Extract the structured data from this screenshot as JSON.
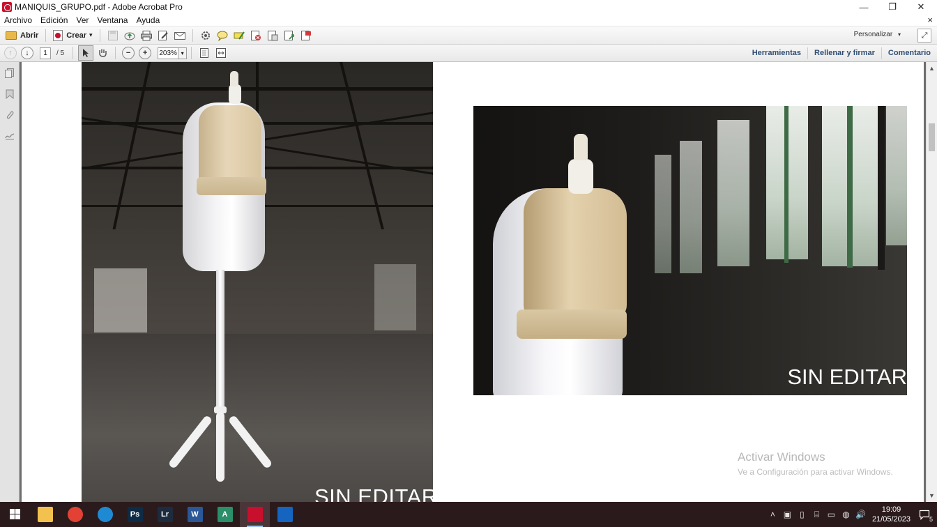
{
  "window": {
    "title": "MANIQUIS_GRUPO.pdf - Adobe Acrobat Pro",
    "minimize_glyph": "—",
    "restore_glyph": "❐",
    "close_glyph": "✕"
  },
  "menu": {
    "items": [
      "Archivo",
      "Edición",
      "Ver",
      "Ventana",
      "Ayuda"
    ],
    "close_doc_glyph": "×"
  },
  "toolbar": {
    "open_label": "Abrir",
    "create_label": "Crear",
    "create_dropdown_glyph": "▾",
    "personalizar_label": "Personalizar",
    "personalizar_dropdown_glyph": "▾",
    "icons": [
      "save-icon",
      "upload-cloud-icon",
      "print-icon",
      "edit-document-icon",
      "email-icon",
      "settings-gear-icon",
      "comment-bubble-icon",
      "highlight-marker-icon",
      "pdf-delete-icon",
      "pdf-export-icon",
      "pdf-combine-icon",
      "pdf-sign-icon"
    ]
  },
  "nav": {
    "current_page": "1",
    "total_pages": "/ 5",
    "zoom": "203%",
    "zoom_dropdown_glyph": "▾",
    "panels": [
      "Herramientas",
      "Rellenar y firmar",
      "Comentario"
    ]
  },
  "document": {
    "caption_left": "SIN EDITAR",
    "caption_right": "SIN EDITAR"
  },
  "watermark": {
    "title": "Activar Windows",
    "subtitle": "Ve a Configuración para activar Windows."
  },
  "taskbar": {
    "apps": [
      {
        "name": "file-explorer",
        "label": "",
        "color": "#f2c14e",
        "active": false
      },
      {
        "name": "chrome",
        "label": "",
        "color": "#e34133",
        "active": false
      },
      {
        "name": "edge",
        "label": "",
        "color": "#1f8ad4",
        "active": false
      },
      {
        "name": "photoshop",
        "label": "Ps",
        "color": "#0e2b45",
        "active": false
      },
      {
        "name": "lightroom",
        "label": "Lr",
        "color": "#1c2c3e",
        "active": false
      },
      {
        "name": "word",
        "label": "W",
        "color": "#2b5797",
        "active": false
      },
      {
        "name": "access",
        "label": "A",
        "color": "#2a8f6a",
        "active": false
      },
      {
        "name": "acrobat",
        "label": "",
        "color": "#c8102e",
        "active": true
      },
      {
        "name": "photos",
        "label": "",
        "color": "#1565c0",
        "active": false
      }
    ],
    "tray_glyphs": [
      "˄",
      "▣",
      "▯",
      "⌸",
      "▭",
      "◍",
      "🔊"
    ],
    "time": "19:09",
    "date": "21/05/2023",
    "notification_count": "5"
  }
}
